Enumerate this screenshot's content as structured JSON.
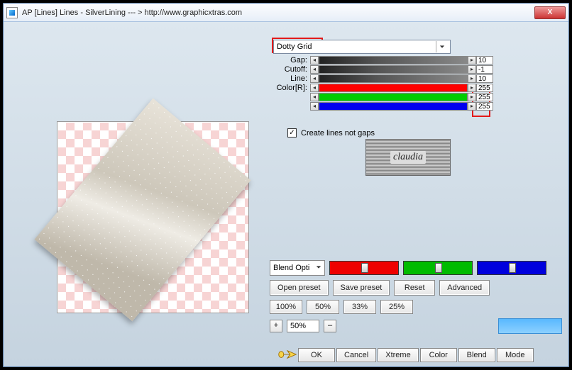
{
  "window": {
    "title": "AP [Lines]  Lines - SilverLining    --- >  http://www.graphicxtras.com",
    "close": "X"
  },
  "preset": {
    "selected": "Dotty Grid"
  },
  "sliders": {
    "labels": {
      "gap": "Gap:",
      "cutoff": "Cutoff:",
      "line": "Line:",
      "color": "Color[R]:"
    },
    "gap": "10",
    "cutoff": "-1",
    "line": "10",
    "r": "255",
    "g": "255",
    "b": "255"
  },
  "checkbox": {
    "label": "Create lines not gaps",
    "checked": true
  },
  "logo": "claudia",
  "blend": {
    "label": "Blend Opti"
  },
  "buttons": {
    "open_preset": "Open preset",
    "save_preset": "Save preset",
    "reset": "Reset",
    "advanced": "Advanced",
    "p100": "100%",
    "p50": "50%",
    "p33": "33%",
    "p25": "25%",
    "plus": "+",
    "minus": "–",
    "zoom": "50%",
    "ok": "OK",
    "cancel": "Cancel",
    "xtreme": "Xtreme",
    "color": "Color",
    "blend": "Blend",
    "mode": "Mode"
  }
}
